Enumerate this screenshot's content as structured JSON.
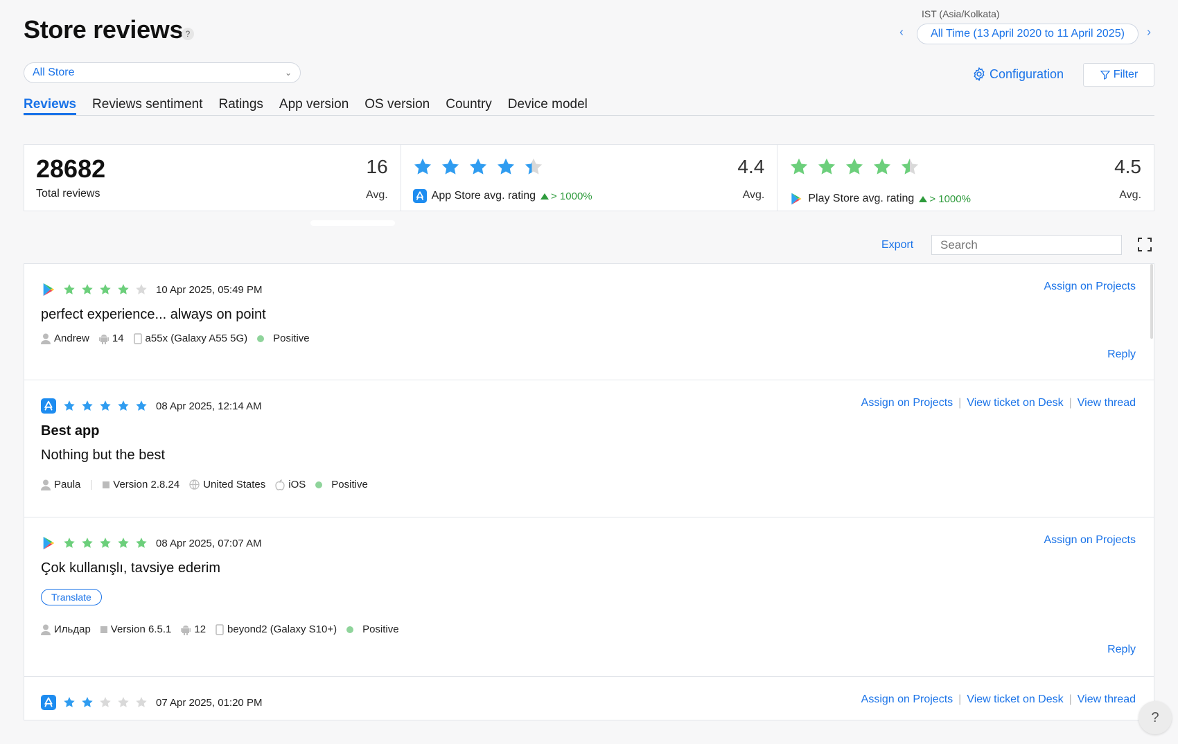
{
  "header": {
    "title": "Store reviews",
    "help": "?",
    "timezone": "IST (Asia/Kolkata)",
    "date_range": "All Time (13 April 2020 to 11 April 2025)",
    "prev": "‹",
    "next": "›"
  },
  "store_select": {
    "value": "All Store"
  },
  "toolbar": {
    "configuration": "Configuration",
    "filter": "Filter",
    "export": "Export",
    "search_placeholder": "Search"
  },
  "tabs": [
    "Reviews",
    "Reviews sentiment",
    "Ratings",
    "App version",
    "OS version",
    "Country",
    "Device model"
  ],
  "stats": {
    "total": {
      "value": "28682",
      "label": "Total reviews",
      "avg_value": "16",
      "avg_label": "Avg."
    },
    "app_store": {
      "label": "App Store avg. rating",
      "trend": "> 1000%",
      "value": "4.4",
      "avg_label": "Avg.",
      "rating": 4.4
    },
    "play_store": {
      "label": "Play Store avg. rating",
      "trend": "> 1000%",
      "value": "4.5",
      "avg_label": "Avg.",
      "rating": 4.5
    }
  },
  "reviews": [
    {
      "store": "play",
      "rating": 4,
      "date": "10 Apr 2025, 05:49 PM",
      "actions": [
        "Assign on Projects"
      ],
      "text": "perfect experience... always on point",
      "meta": {
        "user": "Andrew",
        "os_version": "14",
        "device": "a55x (Galaxy A55 5G)",
        "sentiment": "Positive"
      },
      "reply": "Reply"
    },
    {
      "store": "apple",
      "rating": 5,
      "date": "08 Apr 2025, 12:14 AM",
      "actions": [
        "Assign on Projects",
        "View ticket on Desk",
        "View thread"
      ],
      "title": "Best app",
      "text": "Nothing but the best",
      "meta": {
        "user": "Paula",
        "version": "Version 2.8.24",
        "country": "United States",
        "os": "iOS",
        "sentiment": "Positive"
      }
    },
    {
      "store": "play",
      "rating": 5,
      "date": "08 Apr 2025, 07:07 AM",
      "actions": [
        "Assign on Projects"
      ],
      "text": "Çok kullanışlı, tavsiye ederim",
      "translate": "Translate",
      "meta": {
        "user": "Ильдар",
        "version": "Version 6.5.1",
        "os_version": "12",
        "device": "beyond2 (Galaxy S10+)",
        "sentiment": "Positive"
      },
      "reply": "Reply"
    },
    {
      "store": "apple",
      "rating": 2,
      "date": "07 Apr 2025, 01:20 PM",
      "actions": [
        "Assign on Projects",
        "View ticket on Desk",
        "View thread"
      ]
    }
  ],
  "colors": {
    "accent": "#1a73e8",
    "app_store_star": "#2f9cf0",
    "play_store_star": "#6ccf7b",
    "empty_star": "#d9d9d9",
    "positive": "#8fd49b"
  },
  "fab": "?"
}
